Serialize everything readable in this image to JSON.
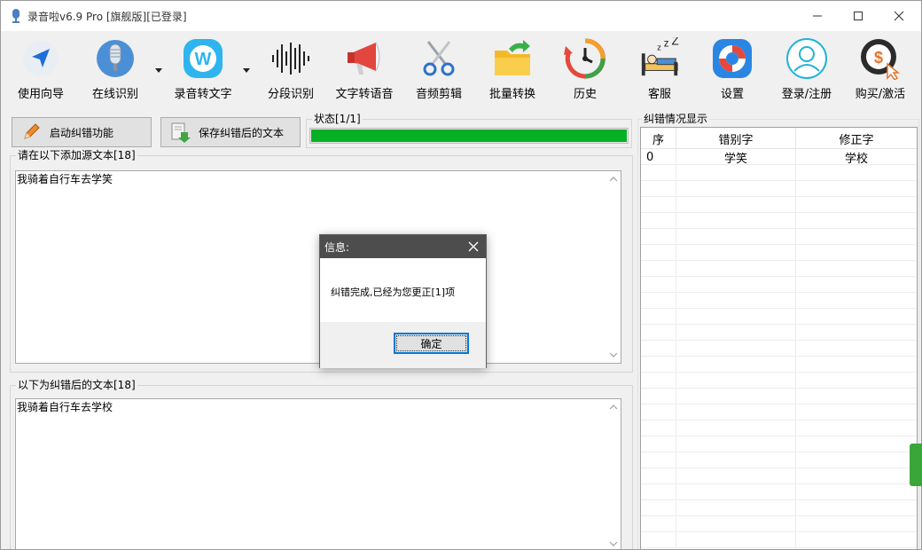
{
  "window": {
    "title": "录音啦v6.9 Pro [旗舰版][已登录]"
  },
  "toolbar": {
    "items": [
      {
        "label": "使用向导",
        "icon": "navigation-arrow-icon"
      },
      {
        "label": "在线识别",
        "icon": "microphone-icon"
      },
      {
        "label": "录音转文字",
        "icon": "w-logo-icon"
      },
      {
        "label": "分段识别",
        "icon": "waveform-icon"
      },
      {
        "label": "文字转语音",
        "icon": "megaphone-icon"
      },
      {
        "label": "音频剪辑",
        "icon": "scissors-icon"
      },
      {
        "label": "批量转换",
        "icon": "folder-arrow-icon"
      },
      {
        "label": "历史",
        "icon": "history-clock-icon"
      },
      {
        "label": "客服",
        "icon": "sleeping-bed-icon"
      },
      {
        "label": "设置",
        "icon": "lifebuoy-icon"
      },
      {
        "label": "登录/注册",
        "icon": "user-icon"
      },
      {
        "label": "购买/激活",
        "icon": "dollar-coin-icon"
      }
    ]
  },
  "actions": {
    "start_label": "启动纠错功能",
    "save_label": "保存纠错后的文本"
  },
  "status": {
    "label": "状态[1/1]",
    "progress": 1.0,
    "progress_color": "#06b025"
  },
  "source": {
    "group_label": "请在以下添加源文本[18]",
    "text": "我骑着自行车去学笑"
  },
  "corrected": {
    "group_label": "以下为纠错后的文本[18]",
    "text": "我骑着自行车去学校"
  },
  "corrections": {
    "group_label": "纠错情况显示",
    "columns": [
      "序",
      "错别字",
      "修正字"
    ],
    "rows": [
      [
        "0",
        "学笑",
        "学校"
      ]
    ]
  },
  "dialog": {
    "title": "信息:",
    "message": "纠错完成,已经为您更正[1]项",
    "ok_label": "确定"
  }
}
